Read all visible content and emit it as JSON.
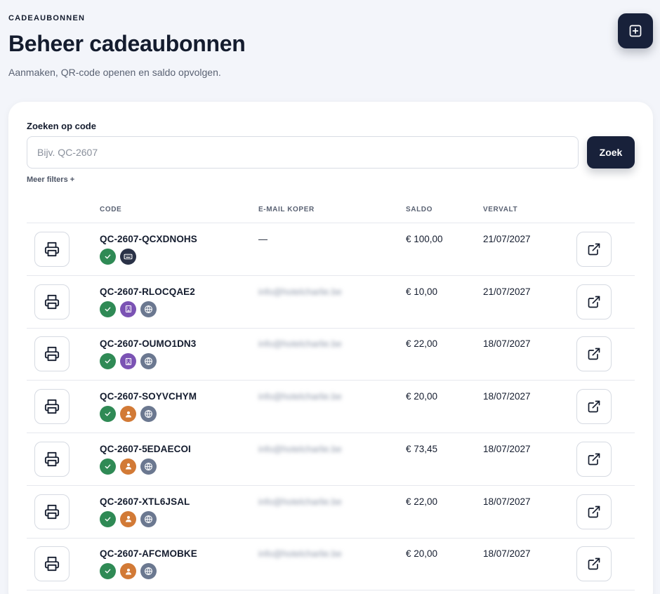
{
  "header": {
    "eyebrow": "CADEAUBONNEN",
    "title": "Beheer cadeaubonnen",
    "subtitle": "Aanmaken, QR-code openen en saldo opvolgen."
  },
  "actions": {
    "add_icon": "plus-square-icon"
  },
  "search": {
    "label": "Zoeken op code",
    "placeholder": "Bijv. QC-2607",
    "value": "",
    "button_label": "Zoek",
    "more_filters": "Meer filters +"
  },
  "table": {
    "columns": [
      "CODE",
      "E-MAIL KOPER",
      "SALDO",
      "VERVALT"
    ],
    "rows": [
      {
        "code": "QC-2607-QCXDNOHS",
        "email": "—",
        "email_redacted": false,
        "saldo": "€ 100,00",
        "vervalt": "21/07/2027",
        "badges": [
          "check-icon",
          "keyboard-icon"
        ]
      },
      {
        "code": "QC-2607-RLOCQAE2",
        "email": "info@hotelcharlie.be",
        "email_redacted": true,
        "saldo": "€ 10,00",
        "vervalt": "21/07/2027",
        "badges": [
          "check-icon",
          "building-icon",
          "globe-icon"
        ]
      },
      {
        "code": "QC-2607-OUMO1DN3",
        "email": "info@hotelcharlie.be",
        "email_redacted": true,
        "saldo": "€ 22,00",
        "vervalt": "18/07/2027",
        "badges": [
          "check-icon",
          "building-icon",
          "globe-icon"
        ]
      },
      {
        "code": "QC-2607-SOYVCHYM",
        "email": "info@hotelcharlie.be",
        "email_redacted": true,
        "saldo": "€ 20,00",
        "vervalt": "18/07/2027",
        "badges": [
          "check-icon",
          "user-icon",
          "globe-icon"
        ]
      },
      {
        "code": "QC-2607-5EDAECOI",
        "email": "info@hotelcharlie.be",
        "email_redacted": true,
        "saldo": "€ 73,45",
        "vervalt": "18/07/2027",
        "badges": [
          "check-icon",
          "user-icon",
          "globe-icon"
        ]
      },
      {
        "code": "QC-2607-XTL6JSAL",
        "email": "info@hotelcharlie.be",
        "email_redacted": true,
        "saldo": "€ 22,00",
        "vervalt": "18/07/2027",
        "badges": [
          "check-icon",
          "user-icon",
          "globe-icon"
        ]
      },
      {
        "code": "QC-2607-AFCMOBKE",
        "email": "info@hotelcharlie.be",
        "email_redacted": true,
        "saldo": "€ 20,00",
        "vervalt": "18/07/2027",
        "badges": [
          "check-icon",
          "user-icon",
          "globe-icon"
        ]
      }
    ]
  },
  "colors": {
    "primary_dark": "#18213a",
    "badge_green": "#2f8a55",
    "badge_dark": "#2a3247",
    "badge_purple": "#7b53b4",
    "badge_orange": "#d27a36",
    "badge_slate": "#6b7890"
  }
}
